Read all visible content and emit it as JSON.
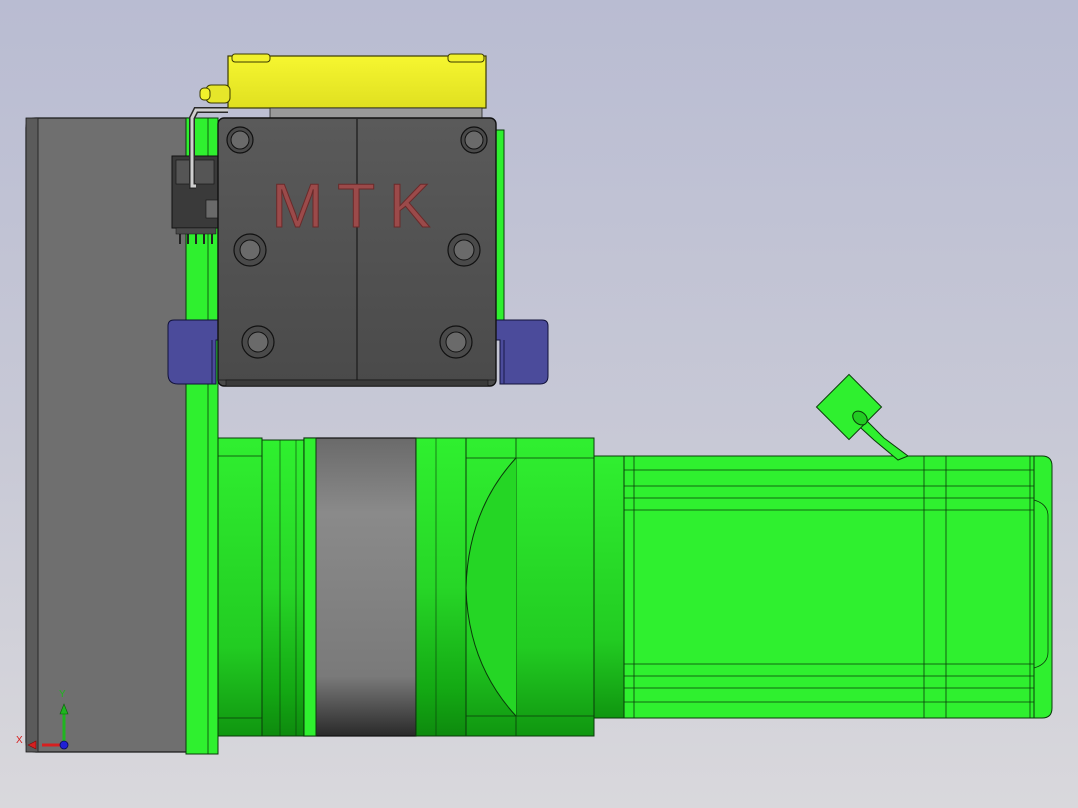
{
  "logo": {
    "text": "MTK",
    "color": "#9b4a4a"
  },
  "triad": {
    "x_label": "X",
    "y_label": "Y",
    "x_color": "#d62020",
    "y_color": "#1fb51f",
    "z_color": "#2020d6"
  },
  "colors": {
    "background_top": "#b9bcd2",
    "background_bottom": "#d9d8dc",
    "motor_green": "#2ff02f",
    "gearbox_gray": "#7a7a7a",
    "plate_gray": "#6e6e6e",
    "box_dark": "#555555",
    "bracket_yellow": "#f1f12c",
    "clip_blue": "#4a4a9a"
  }
}
